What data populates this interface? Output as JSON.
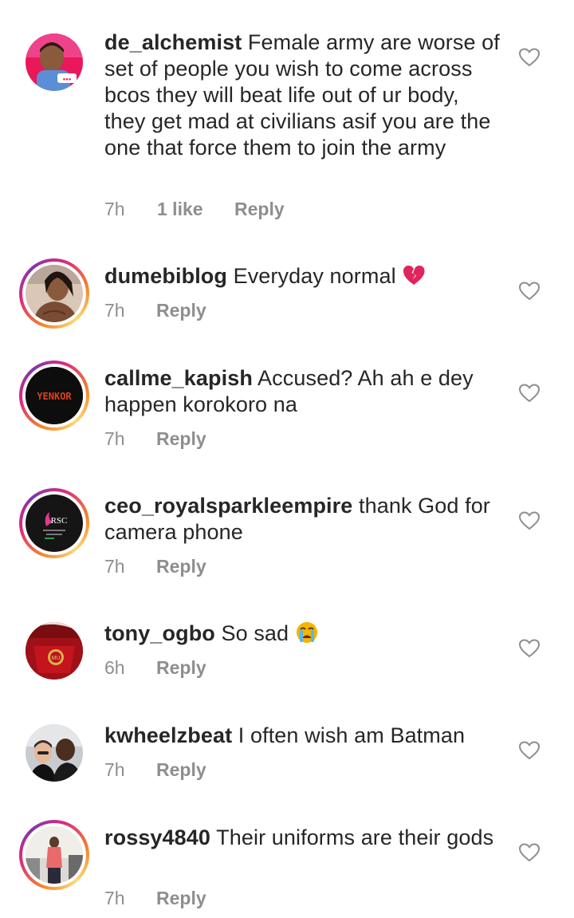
{
  "comments": [
    {
      "username": "de_alchemist",
      "text": "Female army are worse of set of people you wish to come across bcos they will beat life out of ur body, they get mad at civilians asif you are the one that force them to join the army",
      "time": "7h",
      "likes": "1 like",
      "reply": "Reply",
      "story_ring": false,
      "avatar": "avatar-man-red-background"
    },
    {
      "username": "dumebiblog",
      "text": "Everyday normal",
      "emoji": "broken-heart-emoji",
      "time": "7h",
      "reply": "Reply",
      "story_ring": true,
      "avatar": "avatar-woman-photo"
    },
    {
      "username": "callme_kapish",
      "text": "Accused? Ah ah e dey happen korokoro na",
      "time": "7h",
      "reply": "Reply",
      "story_ring": true,
      "avatar": "avatar-yenkor-logo",
      "avatar_logo_text": "YENKOR"
    },
    {
      "username": "ceo_royalsparkleempire",
      "text": "thank God for camera phone",
      "time": "7h",
      "reply": "Reply",
      "story_ring": true,
      "avatar": "avatar-rsc-logo",
      "avatar_logo_text": "RSC"
    },
    {
      "username": "tony_ogbo",
      "text": "So sad",
      "emoji": "crying-face-emoji",
      "time": "6h",
      "reply": "Reply",
      "story_ring": false,
      "avatar": "avatar-red-jersey"
    },
    {
      "username": "kwheelzbeat",
      "text": "I often wish am Batman",
      "time": "7h",
      "reply": "Reply",
      "story_ring": false,
      "avatar": "avatar-two-men-selfie"
    },
    {
      "username": "rossy4840",
      "text": "Their uniforms are their gods",
      "time": "7h",
      "reply": "Reply",
      "story_ring": true,
      "avatar": "avatar-woman-standing"
    }
  ],
  "colors": {
    "text": "#262626",
    "meta": "#8e8e8e",
    "heart_outline": "#8e8e8e",
    "broken_heart": "#e0245e",
    "crying_face": "#f4b400"
  }
}
